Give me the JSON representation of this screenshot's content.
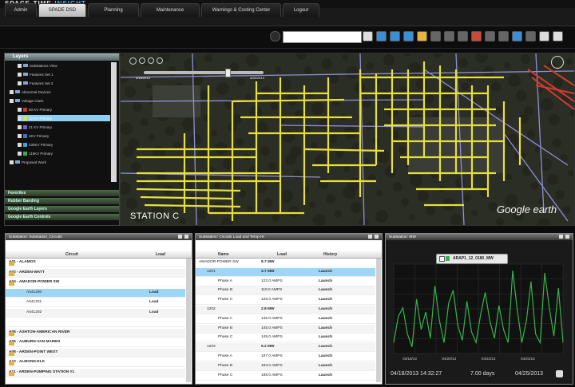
{
  "app": {
    "brand_main": "SPACE-TIME",
    "brand_accent": "INSIGHT",
    "tabs": [
      {
        "label": "Admin",
        "active": false
      },
      {
        "label": "SPADE DSD",
        "active": true
      },
      {
        "label": "Planning",
        "active": false
      },
      {
        "label": "Maintenance",
        "active": false
      },
      {
        "label": "Warnings & Costing Center",
        "active": false
      },
      {
        "label": "Logout",
        "active": false
      }
    ],
    "search_value": ""
  },
  "layers": {
    "title": "Layers",
    "items": [
      {
        "label": "Substations View",
        "level": 2,
        "swatch": ""
      },
      {
        "label": "Features Set 1",
        "level": 2,
        "swatch": ""
      },
      {
        "label": "Features Set 2",
        "level": 2,
        "swatch": ""
      },
      {
        "label": "Abnormal Devices",
        "level": 1,
        "swatch": ""
      },
      {
        "label": "Voltage Class",
        "level": 1,
        "swatch": ""
      },
      {
        "label": "60 KV Primary",
        "level": 2,
        "swatch": "#c0392b"
      },
      {
        "label": "12 KV Primary",
        "level": 2,
        "swatch": "#e8e043",
        "selected": true
      },
      {
        "label": "21 KV Primary",
        "level": 2,
        "swatch": "#7b5cc9"
      },
      {
        "label": "4KV Primary",
        "level": 2,
        "swatch": "#4a6fb5"
      },
      {
        "label": "230KV Primary",
        "level": 2,
        "swatch": "#3aa7d6"
      },
      {
        "label": "115KV Primary",
        "level": 2,
        "swatch": "#37b34a"
      },
      {
        "label": "Proposed Work",
        "level": 1,
        "swatch": ""
      }
    ],
    "sections": [
      "Favorites",
      "Rubber Banding",
      "Google Earth Layers",
      "Google Earth Controls"
    ]
  },
  "map": {
    "date_start": "4/18/2013",
    "date_end": "4/25/2013",
    "station_label": "STATION C",
    "watermark": "Google earth",
    "colors": {
      "feeder": "#e6df3f",
      "road": "#8f8fd8",
      "background": "#2b2e24"
    }
  },
  "circuits_panel": {
    "title": "Substation: Substation_Circuits",
    "headers": {
      "circuit": "Circuit",
      "load": "Load"
    },
    "rows": [
      {
        "label": "A01 - ALAMOS",
        "type": "folder",
        "load": ""
      },
      {
        "label": "A02 - ARDEN-WATT",
        "type": "folder",
        "load": ""
      },
      {
        "label": "A04 - AMADOR-POWER SW",
        "type": "folder-open",
        "load": ""
      },
      {
        "label": "A041200",
        "type": "child",
        "load": "Load",
        "selected": true
      },
      {
        "label": "A041201",
        "type": "child",
        "load": "Load"
      },
      {
        "label": "A041202",
        "type": "child",
        "load": "Load"
      },
      {
        "label": "",
        "type": "blank",
        "load": ""
      },
      {
        "label": "A05 - ASHTON-AMERICAN RIVER",
        "type": "folder",
        "load": ""
      },
      {
        "label": "A06 - AUBURN-VAN MAREN",
        "type": "folder",
        "load": ""
      },
      {
        "label": "A08 - ARDEN-POINT WEST",
        "type": "folder",
        "load": ""
      },
      {
        "label": "A10 - ALMOND-ELK",
        "type": "folder",
        "load": ""
      },
      {
        "label": "A11 - ARDEN-PUMPING STATION #1",
        "type": "folder",
        "load": ""
      }
    ]
  },
  "load_panel": {
    "title": "Substation: Circuits Load and Temp HI",
    "headers": {
      "name": "Name",
      "load": "Load",
      "history": "History"
    },
    "rows": [
      {
        "name": "AMADOR-POWER SW",
        "load": "8.7 MW",
        "history": "",
        "kind": "header"
      },
      {
        "name": "1201",
        "load": "3.7 MW",
        "history": "Launch",
        "kind": "circuit",
        "selected": true
      },
      {
        "name": "Phase A",
        "load": "122.0 AMPS",
        "history": "Launch",
        "kind": "phase"
      },
      {
        "name": "Phase B",
        "load": "119.0 AMPS",
        "history": "Launch",
        "kind": "phase"
      },
      {
        "name": "Phase C",
        "load": "126.0 AMPS",
        "history": "Launch",
        "kind": "phase"
      },
      {
        "name": "1202",
        "load": "2.8 MW",
        "history": "Launch",
        "kind": "circuit"
      },
      {
        "name": "Phase A",
        "load": "145.0 AMPS",
        "history": "Launch",
        "kind": "phase"
      },
      {
        "name": "Phase B",
        "load": "145.0 AMPS",
        "history": "Launch",
        "kind": "phase"
      },
      {
        "name": "Phase C",
        "load": "145.0 AMPS",
        "history": "Launch",
        "kind": "phase"
      },
      {
        "name": "1203",
        "load": "5.2 MW",
        "history": "Launch",
        "kind": "circuit"
      },
      {
        "name": "Phase A",
        "load": "197.0 AMPS",
        "history": "Launch",
        "kind": "phase"
      },
      {
        "name": "Phase B",
        "load": "193.0 AMPS",
        "history": "Launch",
        "kind": "phase"
      },
      {
        "name": "Phase C",
        "load": "198.0 AMPS",
        "history": "Launch",
        "kind": "phase"
      }
    ]
  },
  "chart_panel": {
    "title": "Substation: MW",
    "legend": "ARAP1_12_0180_MW",
    "footer_start": "04/18/2013  14:32:27",
    "footer_span": "7.00 days",
    "footer_end": "04/25/2013"
  },
  "chart_data": {
    "type": "line",
    "series": [
      {
        "name": "ARAP1_12_0180_MW",
        "color": "#36b34a",
        "values": [
          1.0,
          2.2,
          2.6,
          1.4,
          0.8,
          3.0,
          1.6,
          2.4,
          1.2,
          3.6,
          2.0,
          1.0,
          2.8,
          3.4,
          1.8,
          1.1,
          2.9,
          1.5,
          1.0,
          2.3,
          3.3,
          2.0,
          1.2,
          2.7,
          1.6,
          1.0,
          4.3,
          2.5,
          1.0,
          2.0,
          3.8,
          1.4,
          1.0,
          4.2,
          2.6,
          1.3,
          3.5,
          1.0
        ]
      }
    ],
    "xticks": [
      "04/18/13",
      "04/20/13",
      "04/22/13",
      "04/24/13"
    ],
    "grid": true
  }
}
